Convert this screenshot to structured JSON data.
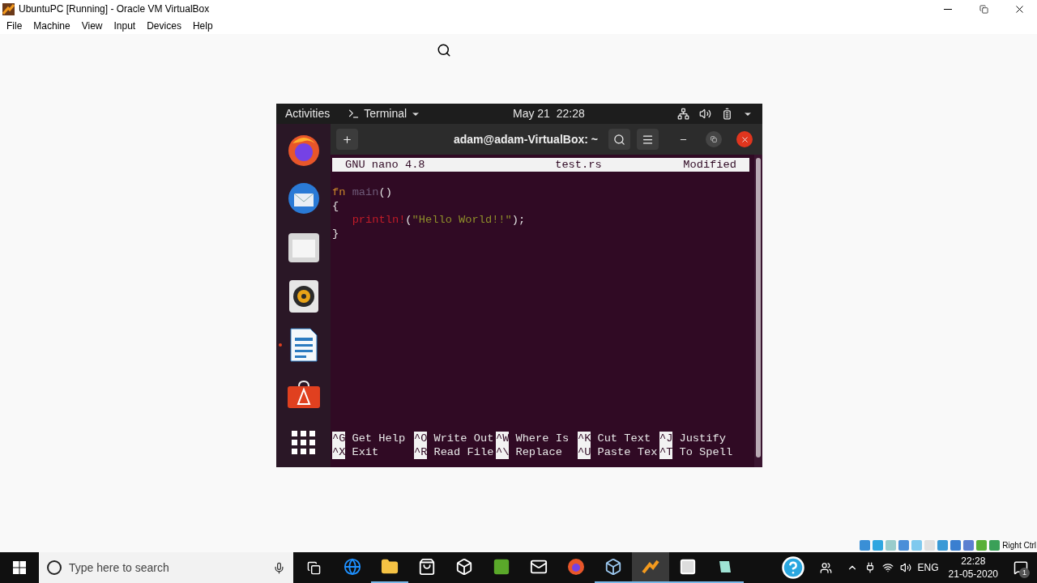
{
  "window": {
    "title": "UbuntuPC [Running] - Oracle VM VirtualBox"
  },
  "menu": [
    "File",
    "Machine",
    "View",
    "Input",
    "Devices",
    "Help"
  ],
  "guest": {
    "topbar": {
      "activities": "Activities",
      "app_menu": "Terminal",
      "clock": "May 21  22:28"
    },
    "dock": [
      {
        "kind": "firefox",
        "running": false
      },
      {
        "kind": "mail",
        "running": false
      },
      {
        "kind": "files",
        "running": false
      },
      {
        "kind": "music",
        "running": false
      },
      {
        "kind": "writer",
        "running": true
      },
      {
        "kind": "software",
        "running": false
      },
      {
        "kind": "apps",
        "running": false
      }
    ],
    "terminal": {
      "title": "adam@adam-VirtualBox: ~",
      "nano": {
        "version": "GNU nano 4.8",
        "file": "test.rs",
        "status": "Modified",
        "lines": [
          [
            {
              "text": "fn",
              "color": "#c8862a"
            },
            {
              "text": " main",
              "color": "#6e5a78"
            },
            {
              "text": "()",
              "color": "#e0e0e0"
            }
          ],
          [
            {
              "text": "{",
              "color": "#e0e0e0"
            }
          ],
          [
            {
              "text": "   println!",
              "color": "#c01c28"
            },
            {
              "text": "(",
              "color": "#e0e0e0"
            },
            {
              "text": "\"Hello World!!\"",
              "color": "#8f8f2a"
            },
            {
              "text": ");",
              "color": "#e0e0e0"
            }
          ],
          [
            {
              "text": "}",
              "color": "#e0e0e0"
            }
          ]
        ],
        "shortcuts": [
          [
            {
              "key": "^G",
              "label": "Get Help"
            },
            {
              "key": "^O",
              "label": "Write Out"
            },
            {
              "key": "^W",
              "label": "Where Is"
            },
            {
              "key": "^K",
              "label": "Cut Text"
            },
            {
              "key": "^J",
              "label": "Justify"
            }
          ],
          [
            {
              "key": "^X",
              "label": "Exit"
            },
            {
              "key": "^R",
              "label": "Read File"
            },
            {
              "key": "^\\",
              "label": "Replace"
            },
            {
              "key": "^U",
              "label": "Paste Tex"
            },
            {
              "key": "^T",
              "label": "To Spell"
            }
          ]
        ]
      }
    }
  },
  "status_bar": {
    "host_key": "Right Ctrl"
  },
  "taskbar": {
    "search": {
      "placeholder": "Type here to search"
    },
    "apps": [
      {
        "kind": "edge",
        "running": false,
        "selected": false
      },
      {
        "kind": "explorer",
        "running": true,
        "selected": false
      },
      {
        "kind": "store",
        "running": false,
        "selected": false
      },
      {
        "kind": "dropbox",
        "running": false,
        "selected": false
      },
      {
        "kind": "evernote",
        "running": false,
        "selected": false
      },
      {
        "kind": "mail",
        "running": false,
        "selected": false
      },
      {
        "kind": "firefox",
        "running": false,
        "selected": false
      },
      {
        "kind": "virtualbox",
        "running": true,
        "selected": false
      },
      {
        "kind": "vm",
        "running": true,
        "selected": true
      },
      {
        "kind": "window",
        "running": true,
        "selected": false
      },
      {
        "kind": "notes",
        "running": true,
        "selected": false
      }
    ],
    "tray": {
      "language": "ENG",
      "time": "22:28",
      "date": "21-05-2020",
      "notifications": "1"
    }
  }
}
